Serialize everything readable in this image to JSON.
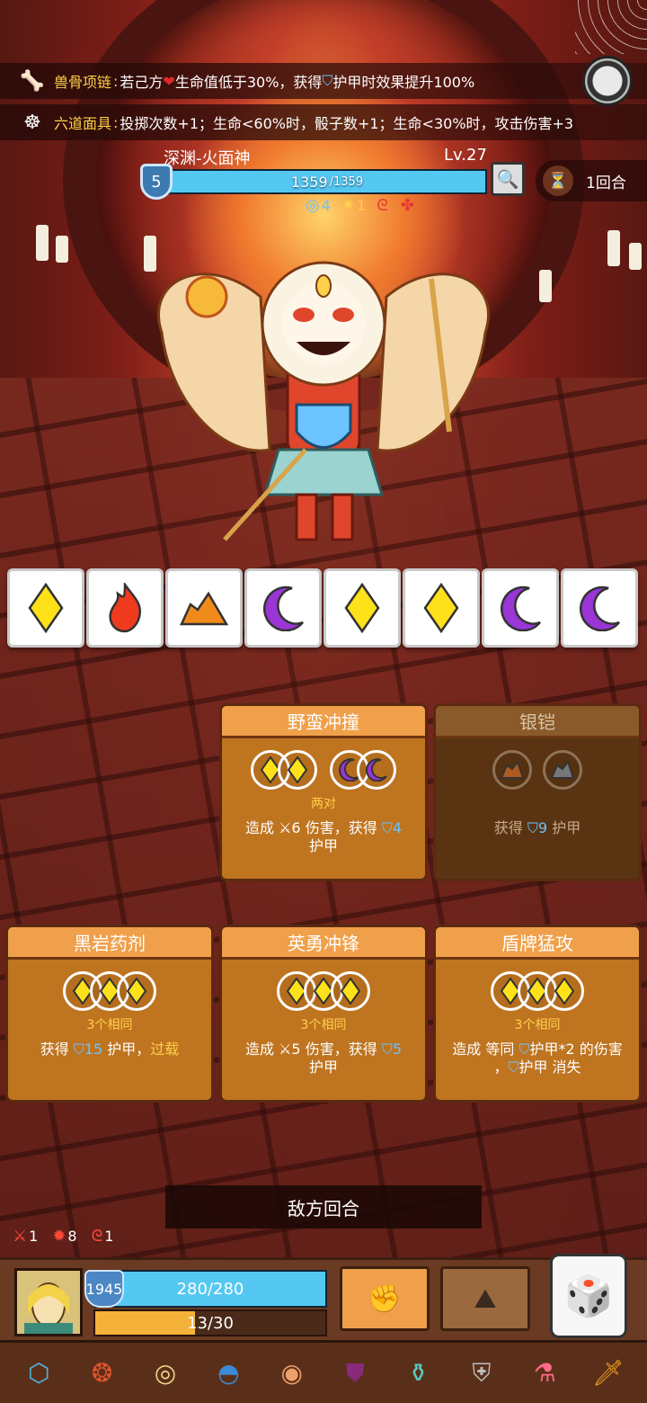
{
  "buffs": [
    {
      "name": "兽骨项链",
      "colon": ":",
      "pre": "若己方",
      "mid": "生命值低于30%，获得",
      "post": "护甲时效果提升100%",
      "icon": "bone-necklace-icon"
    },
    {
      "name": "六道面具",
      "colon": ":",
      "text": "投掷次数+1；生命<60%时，骰子数+1；生命<30%时，攻击伤害+3",
      "icon": "mask-icon"
    }
  ],
  "enemy": {
    "name": "深渊-火面神",
    "level": "Lv.27",
    "shield": "5",
    "hp_current": "1359",
    "hp_max": "/1359",
    "hp_fraction": 1.0,
    "status": [
      {
        "icon": "vortex-icon",
        "value": "4"
      },
      {
        "icon": "spark-icon",
        "value": "1"
      },
      {
        "icon": "curse-icon",
        "value": ""
      },
      {
        "icon": "poison-icon",
        "value": ""
      }
    ]
  },
  "turn": {
    "label": "1回合"
  },
  "dice": [
    "yellow-diamond",
    "red-flame",
    "orange-rock",
    "purple-moon",
    "yellow-diamond",
    "yellow-diamond",
    "purple-moon",
    "purple-moon"
  ],
  "cards": [
    {
      "title": "野蛮冲撞",
      "req": "两对",
      "effect_pre": "造成",
      "dmg": "6",
      "effect_mid": "伤害，获得",
      "armor": "4",
      "effect_post": "护甲",
      "disabled": false
    },
    {
      "title": "银铠",
      "req": "",
      "effect_pre": "获得",
      "armor": "9",
      "effect_post": "护甲",
      "disabled": true
    },
    {
      "title": "黑岩药剂",
      "req": "3个相同",
      "effect_pre": "获得",
      "armor": "15",
      "effect_mid": "护甲，",
      "highlight": "过载",
      "disabled": false
    },
    {
      "title": "英勇冲锋",
      "req": "3个相同",
      "effect_pre": "造成",
      "dmg": "5",
      "effect_mid": "伤害，获得",
      "armor": "5",
      "effect_post": "护甲",
      "disabled": false
    },
    {
      "title": "盾牌猛攻",
      "req": "3个相同",
      "effect_pre": "造成 等同",
      "effect_mid": "护甲*2 的伤害",
      "effect_post_pre": "，",
      "effect_post": "护甲 消失",
      "disabled": false
    }
  ],
  "enemy_turn_label": "敌方回合",
  "player": {
    "status": [
      {
        "icon": "attack-up-icon",
        "value": "1"
      },
      {
        "icon": "burst-icon",
        "value": "8"
      },
      {
        "icon": "curse-icon",
        "value": "1"
      }
    ],
    "armor": "1945",
    "hp": "280/280",
    "hp_fraction": 1.0,
    "exp": "13/30",
    "exp_fraction": 0.433
  },
  "relics": [
    "shield-relic-icon",
    "owl-mask-icon",
    "mirror-icon",
    "blue-cap-icon",
    "donut-icon",
    "armor-vest-icon",
    "urn-icon",
    "chainmail-icon",
    "potion-icon",
    "flame-sword-icon"
  ],
  "colors": {
    "accent": "#ffd14a",
    "hp": "#55c8f2",
    "armor": "#6bc3ff",
    "card": "#bf7420"
  }
}
